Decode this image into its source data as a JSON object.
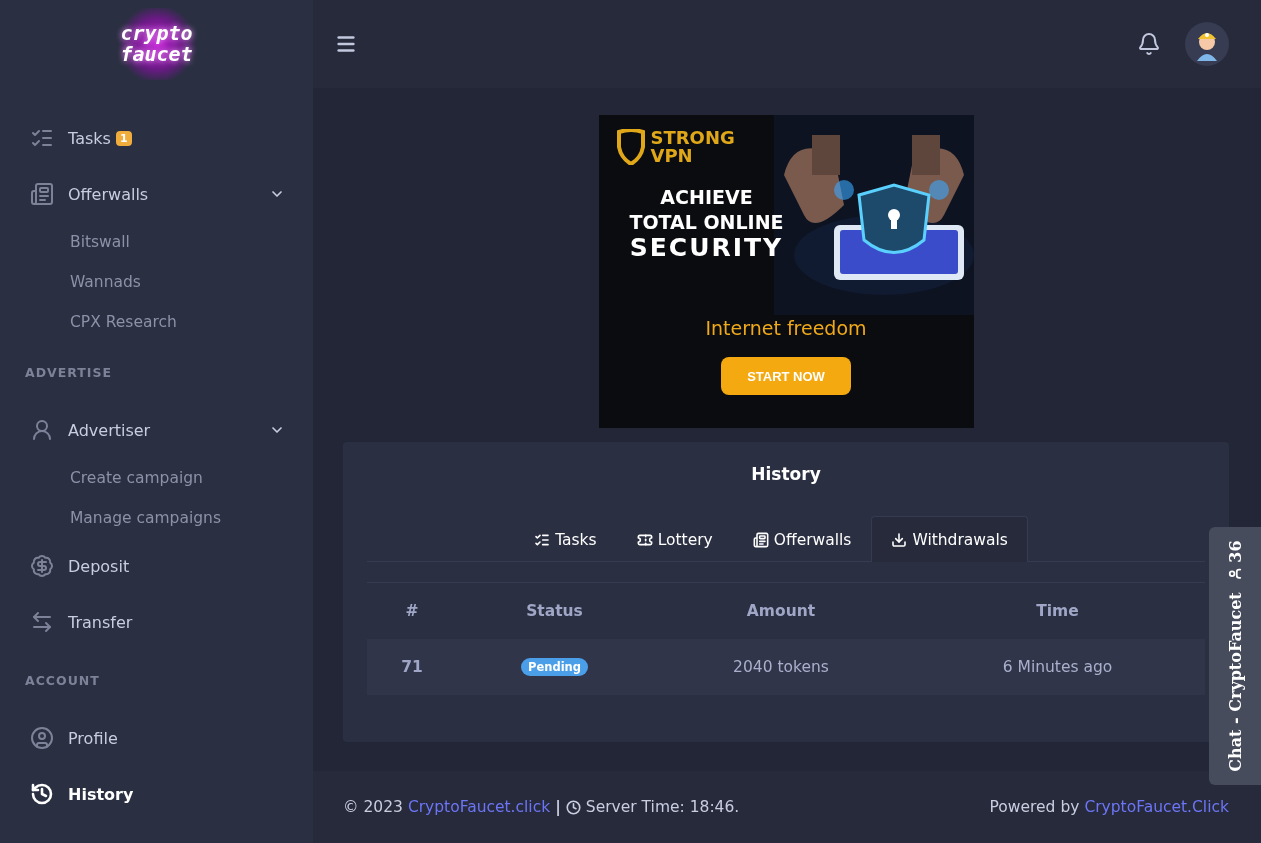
{
  "logo": {
    "line1": "crypto",
    "line2": "faucet"
  },
  "sidebar": [
    {
      "kind": "item",
      "label": "Tasks",
      "badge": "1",
      "active": false
    },
    {
      "kind": "item",
      "label": "Offerwalls",
      "expanded": true,
      "active": false
    },
    {
      "kind": "sub",
      "label": "Bitswall"
    },
    {
      "kind": "sub",
      "label": "Wannads"
    },
    {
      "kind": "sub",
      "label": "CPX Research"
    },
    {
      "kind": "header",
      "label": "ADVERTISE"
    },
    {
      "kind": "item",
      "label": "Advertiser",
      "expanded": true,
      "active": false
    },
    {
      "kind": "sub",
      "label": "Create campaign"
    },
    {
      "kind": "sub",
      "label": "Manage campaigns"
    },
    {
      "kind": "item",
      "label": "Deposit",
      "active": false
    },
    {
      "kind": "item",
      "label": "Transfer",
      "active": false
    },
    {
      "kind": "header",
      "label": "ACCOUNT"
    },
    {
      "kind": "item",
      "label": "Profile",
      "active": false
    },
    {
      "kind": "item",
      "label": "History",
      "active": true
    }
  ],
  "ad": {
    "brand_line1": "STRONG",
    "brand_line2": "VPN",
    "headline": [
      "ACHIEVE",
      "TOTAL ONLINE",
      "SECURITY"
    ],
    "tagline": "Internet freedom",
    "button": "START NOW"
  },
  "history": {
    "title": "History",
    "tabs": [
      {
        "label": "Tasks",
        "selected": false
      },
      {
        "label": "Lottery",
        "selected": false
      },
      {
        "label": "Offerwalls",
        "selected": false
      },
      {
        "label": "Withdrawals",
        "selected": true
      }
    ],
    "columns": [
      "#",
      "Status",
      "Amount",
      "Time"
    ],
    "rows": [
      {
        "id": "71",
        "status": "Pending",
        "color": "#4b9ee8",
        "amount": "2040 tokens",
        "time": "6 Minutes ago"
      }
    ]
  },
  "footer": {
    "copyright": "© 2023",
    "site_link": "CryptoFaucet.click",
    "separator": "|",
    "server_time": "Server Time: 18:46.",
    "powered_by": "Powered by",
    "powered_link": "CryptoFaucet.Click"
  },
  "chat": {
    "label": "Chat - CryptoFaucet",
    "users": "36"
  }
}
